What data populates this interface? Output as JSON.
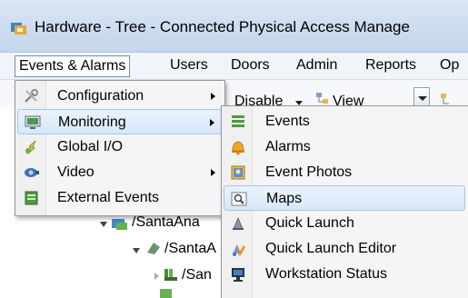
{
  "window": {
    "title": "Hardware - Tree - Connected Physical Access Manage"
  },
  "menubar": {
    "items": [
      {
        "label": "Events & Alarms"
      },
      {
        "label": "Users"
      },
      {
        "label": "Doors"
      },
      {
        "label": "Admin"
      },
      {
        "label": "Reports"
      },
      {
        "label": "Op"
      }
    ]
  },
  "toolbar": {
    "disable_label": "Disable",
    "view_label": "View"
  },
  "tree": {
    "rows": [
      {
        "label": "/SantaAna"
      },
      {
        "label": "/SantaA"
      },
      {
        "label": "/San"
      }
    ]
  },
  "events_menu": {
    "items": [
      {
        "label": "Configuration",
        "icon": "wrench-icon",
        "has_submenu": true
      },
      {
        "label": "Monitoring",
        "icon": "monitor-icon",
        "has_submenu": true,
        "highlighted": true
      },
      {
        "label": "Global I/O",
        "icon": "global-io-icon",
        "has_submenu": false
      },
      {
        "label": "Video",
        "icon": "video-camera-icon",
        "has_submenu": true
      },
      {
        "label": "External Events",
        "icon": "external-events-icon",
        "has_submenu": false
      }
    ]
  },
  "monitoring_submenu": {
    "items": [
      {
        "label": "Events",
        "icon": "events-list-icon"
      },
      {
        "label": "Alarms",
        "icon": "alarm-bell-icon"
      },
      {
        "label": "Event Photos",
        "icon": "event-photos-icon"
      },
      {
        "label": "Maps",
        "icon": "maps-icon",
        "highlighted": true
      },
      {
        "label": "Quick Launch",
        "icon": "quick-launch-icon"
      },
      {
        "label": "Quick Launch Editor",
        "icon": "quick-launch-editor-icon"
      },
      {
        "label": "Workstation Status",
        "icon": "workstation-status-icon"
      }
    ]
  },
  "colors": {
    "highlight_bg": "#d8e8f9",
    "highlight_border": "#a9c5ea",
    "menu_bg": "#f5f5f5",
    "titlebar_bg": "#cddcef"
  }
}
